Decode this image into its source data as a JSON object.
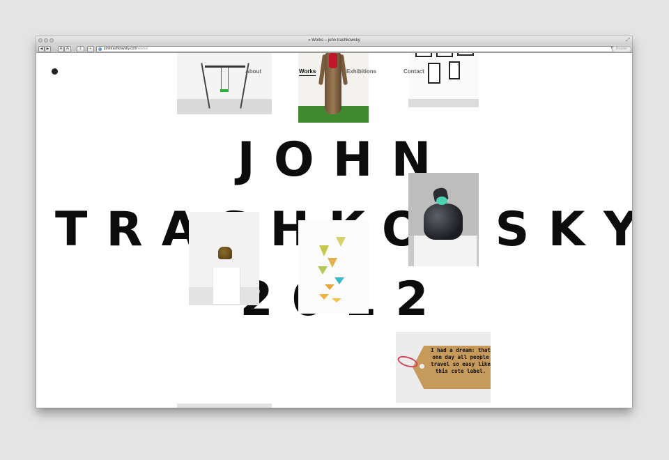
{
  "browser": {
    "window_title": "» Works – john trashkowsky",
    "url_domain": "johntrashkowsky.com",
    "url_path": "/works/",
    "reader_label": "Reader",
    "font_small_label": "A",
    "font_large_label": "A",
    "add_label": "+"
  },
  "nav": {
    "about": "About",
    "works": "Works",
    "exhibitions": "Exhibitions",
    "contact": "Contact"
  },
  "hero": {
    "line1": "JOHN",
    "line2": "TRASHKOVSKY",
    "line3": "2012"
  },
  "artwork": {
    "tag_text": "I had a dream: that one day all people travel so easy like this cute label."
  }
}
